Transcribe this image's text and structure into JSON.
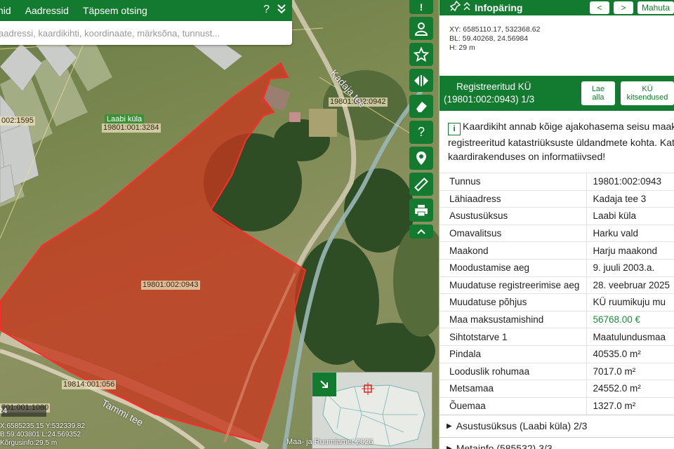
{
  "map": {
    "tabs": [
      "hid",
      "Aadressid",
      "Täpsem otsing"
    ],
    "help_icon": "?",
    "collapse_icon": "double-chevron-down",
    "search_placeholder": "aadressi, kaardikihti, koordinaate, märksõna, tunnust...",
    "labels": {
      "village_tag": "Laabi küla",
      "parcel_1595": "002:1595",
      "parcel_3284": "19801:001:3284",
      "parcel_0942": "19801:002:0942",
      "parcel_0943": "19801:002:0943",
      "road_kadaja": "Kadaja tee",
      "road_tammi": "Tammi tee",
      "parcel_0561": "19814:001:056",
      "parcel_1080": "701:001:1080"
    },
    "tools": [
      "message-icon",
      "user-icon",
      "star-icon",
      "split-arrows-icon",
      "eraser-icon",
      "help-icon",
      "location-pin-icon",
      "ruler-icon",
      "print-icon",
      "chevron-up-icon"
    ],
    "tool_glyphs": [
      "!",
      "?"
    ],
    "scale_text": "24",
    "coords_lines": [
      "X:6585235.15 Y:532339.82",
      "B:59.403801 L:24.569352",
      "Kõrgusinfo:29.5 m"
    ],
    "copyright": "Maa- ja Ruumiamet 2026",
    "highlight_color": "#e0231f"
  },
  "panel": {
    "title": "Infopäring",
    "nav_prev": "<",
    "nav_next": ">",
    "close_label": "Mahuta",
    "xy": "XY: 6585110.17, 532368.62",
    "bl": "BL: 59.40268, 24.56984",
    "h": "H: 29 m",
    "reg_title_line1": "Registreeritud KÜ",
    "reg_title_line2": "(19801:002:0943) 1/3",
    "btn_download_1": "Lae",
    "btn_download_2": "alla",
    "btn_limits_1": "KÜ",
    "btn_limits_2": "kitsendused",
    "notice_lines": [
      "Kaardikiht annab kõige ajakohasema seisu maakat",
      "registreeritud katastriüksuste üldandmete kohta. Katas",
      "kaardirakenduses on informatiivsed!"
    ],
    "attributes": [
      {
        "key": "Tunnus",
        "value": "19801:002:0943"
      },
      {
        "key": "Lähiaadress",
        "value": "Kadaja tee 3"
      },
      {
        "key": "Asustusüksus",
        "value": "Laabi küla"
      },
      {
        "key": "Omavalitsus",
        "value": "Harku vald"
      },
      {
        "key": "Maakond",
        "value": "Harju maakond"
      },
      {
        "key": "Moodustamise aeg",
        "value": "9. juuli 2003.a."
      },
      {
        "key": "Muudatuse registreerimise aeg",
        "value": "28. veebruar 2025"
      },
      {
        "key": "Muudatuse põhjus",
        "value": "KÜ ruumikuju mu"
      },
      {
        "key": "Maa maksustamishind",
        "value": "56768.00 €"
      },
      {
        "key": "Sihtotstarve 1",
        "value": "Maatulundusmaa"
      },
      {
        "key": "Pindala",
        "value": "40535.0 m²"
      },
      {
        "key": "Looduslik rohumaa",
        "value": "7017.0 m²"
      },
      {
        "key": "Metsamaa",
        "value": "24552.0 m²"
      },
      {
        "key": "Õuemaa",
        "value": "1327.0 m²"
      }
    ],
    "sections": [
      "Asustusüksus (Laabi küla) 2/3",
      "Metainfo (585532) 3/3"
    ]
  }
}
